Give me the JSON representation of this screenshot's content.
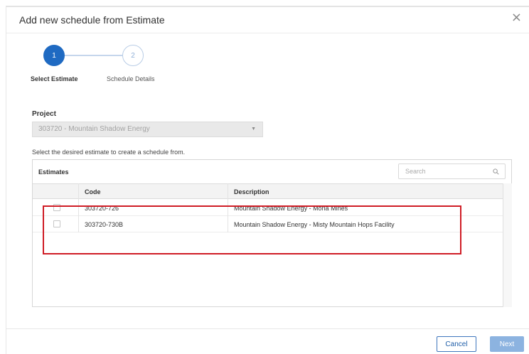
{
  "dialog": {
    "title": "Add new schedule from Estimate",
    "close_glyph": "×"
  },
  "stepper": {
    "steps": [
      {
        "number": "1",
        "label": "Select Estimate",
        "state": "active"
      },
      {
        "number": "2",
        "label": "Schedule Details",
        "state": "inactive"
      }
    ]
  },
  "project": {
    "label": "Project",
    "value": "303720 - Mountain Shadow Energy",
    "arrow_glyph": "▼"
  },
  "instruction": "Select the desired estimate to create a schedule from.",
  "estimates": {
    "title": "Estimates",
    "search_placeholder": "Search",
    "columns": [
      "Code",
      "Description"
    ],
    "rows": [
      {
        "code": "303720-726",
        "description": "Mountain Shadow Energy - Moria Mines",
        "checked": false
      },
      {
        "code": "303720-730B",
        "description": "Mountain Shadow Energy - Misty Mountain Hops Facility",
        "checked": false
      }
    ]
  },
  "footer": {
    "cancel_label": "Cancel",
    "next_label": "Next"
  },
  "colors": {
    "accent": "#1f6ac2",
    "highlight_border": "#cf1c25",
    "next_disabled": "#8cb3e0"
  },
  "icons": {
    "close": "close-icon",
    "search": "search-icon",
    "dropdown": "chevron-down-icon",
    "checkbox": "checkbox-icon"
  }
}
